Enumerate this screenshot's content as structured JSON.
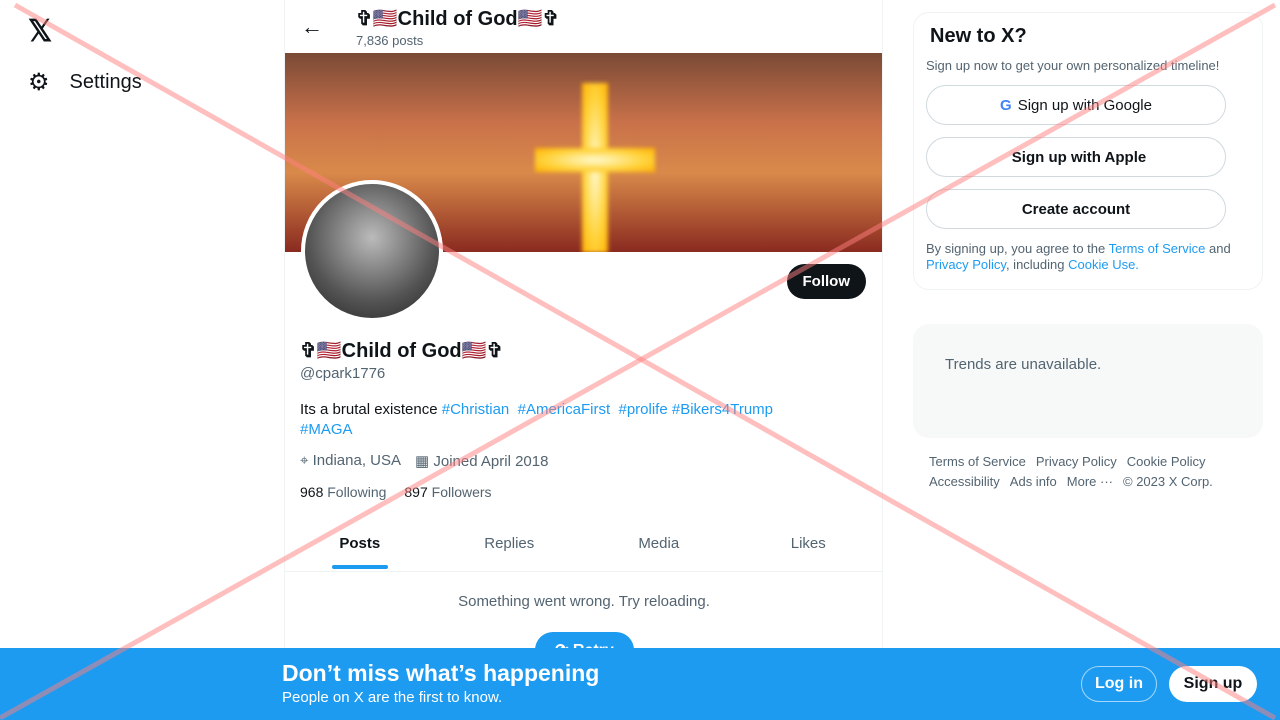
{
  "nav": {
    "logo": "𝕏",
    "settings": "Settings"
  },
  "header": {
    "name": "✞🇺🇸Child of God🇺🇸✞",
    "posts": "7,836 posts"
  },
  "profile": {
    "name": "✞🇺🇸Child of God🇺🇸✞",
    "handle": "@cpark1776",
    "follow": "Follow",
    "bio_text": "Its a brutal existence ",
    "hashtags": [
      "#Christian",
      "#AmericaFirst",
      "#prolife",
      "#Bikers4Trump",
      "#MAGA"
    ],
    "location": "Indiana, USA",
    "joined": "Joined April 2018",
    "following_count": "968",
    "following_label": "Following",
    "followers_count": "897",
    "followers_label": "Followers"
  },
  "tabs": [
    "Posts",
    "Replies",
    "Media",
    "Likes"
  ],
  "feed": {
    "error": "Something went wrong. Try reloading.",
    "retry": "Retry"
  },
  "signup_card": {
    "title": "New to X?",
    "subtitle": "Sign up now to get your own personalized timeline!",
    "google": "Sign up with Google",
    "apple": "Sign up with Apple",
    "create": "Create account",
    "terms_pre": "By signing up, you agree to the ",
    "tos": "Terms of Service",
    "and": " and ",
    "privacy": "Privacy Policy",
    "including": ", including ",
    "cookie": "Cookie Use."
  },
  "trends": "Trends are unavailable.",
  "footer": [
    "Terms of Service",
    "Privacy Policy",
    "Cookie Policy",
    "Accessibility",
    "Ads info",
    "More ···",
    "© 2023 X Corp."
  ],
  "banner_bottom": {
    "title": "Don’t miss what’s happening",
    "subtitle": "People on X are the first to know.",
    "login": "Log in",
    "signup": "Sign up"
  }
}
